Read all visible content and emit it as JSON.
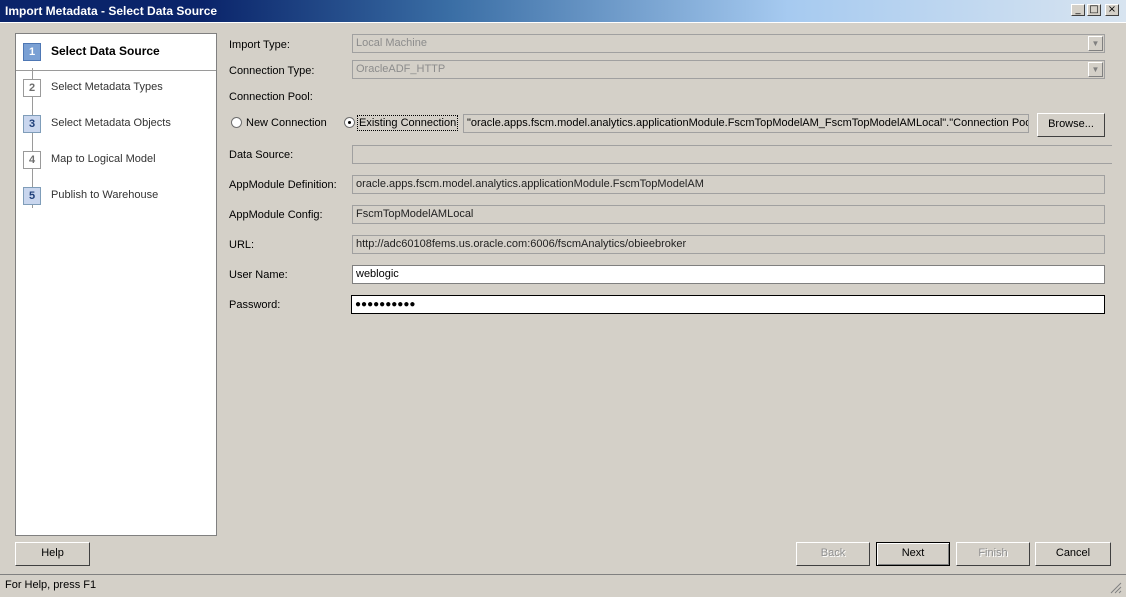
{
  "window": {
    "title": "Import Metadata - Select Data Source",
    "controls": [
      "_",
      "□",
      "×"
    ]
  },
  "steps": [
    {
      "num": "1",
      "label": "Select Data Source",
      "state": "active"
    },
    {
      "num": "2",
      "label": "Select Metadata Types",
      "state": "disabled"
    },
    {
      "num": "3",
      "label": "Select Metadata Objects",
      "state": "enabled"
    },
    {
      "num": "4",
      "label": "Map to Logical Model",
      "state": "disabled"
    },
    {
      "num": "5",
      "label": "Publish to Warehouse",
      "state": "enabled"
    }
  ],
  "form": {
    "import_type_label": "Import Type:",
    "import_type_value": "Local Machine",
    "connection_type_label": "Connection Type:",
    "connection_type_value": "OracleADF_HTTP",
    "connection_pool_label": "Connection Pool:",
    "new_connection_label": "New Connection",
    "existing_connection_label": "Existing Connection",
    "existing_connection_value": "\"oracle.apps.fscm.model.analytics.applicationModule.FscmTopModelAM_FscmTopModelAMLocal\".\"Connection Pool\"",
    "browse_label": "Browse...",
    "data_source_label": "Data Source:",
    "data_source_value": "",
    "appmodule_def_label": "AppModule Definition:",
    "appmodule_def_value": "oracle.apps.fscm.model.analytics.applicationModule.FscmTopModelAM",
    "appmodule_config_label": "AppModule Config:",
    "appmodule_config_value": "FscmTopModelAMLocal",
    "url_label": "URL:",
    "url_value": "http://adc60108fems.us.oracle.com:6006/fscmAnalytics/obieebroker",
    "username_label": "User Name:",
    "username_value": "weblogic",
    "password_label": "Password:",
    "password_value": "●●●●●●●●●●"
  },
  "buttons": {
    "help": "Help",
    "back": "Back",
    "next": "Next",
    "finish": "Finish",
    "cancel": "Cancel"
  },
  "status": {
    "text": "For Help, press F1"
  }
}
